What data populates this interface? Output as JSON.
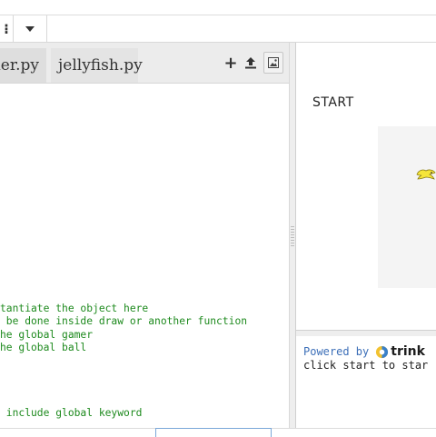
{
  "toolbar": {
    "menu_icon": "menu-dots-icon",
    "caret_icon": "chevron-down-icon"
  },
  "editor": {
    "tabs": [
      {
        "label": "mer.py"
      },
      {
        "label": "jellyfish.py"
      }
    ],
    "actions": {
      "add_label": "+",
      "upload_icon": "upload-icon",
      "image_icon": "image-icon"
    },
    "code_lines": [
      "tantiate the object here",
      " be done inside draw or another function",
      "he global gamer",
      "he global ball",
      " include global keyword"
    ],
    "code_color": "#1e8a1e"
  },
  "output": {
    "start_label": "START",
    "canvas_color": "#f4f4f4",
    "sprite_color": "#f5e53a"
  },
  "console": {
    "powered_by": "Powered by",
    "brand": "trink",
    "message": "click start to star"
  }
}
